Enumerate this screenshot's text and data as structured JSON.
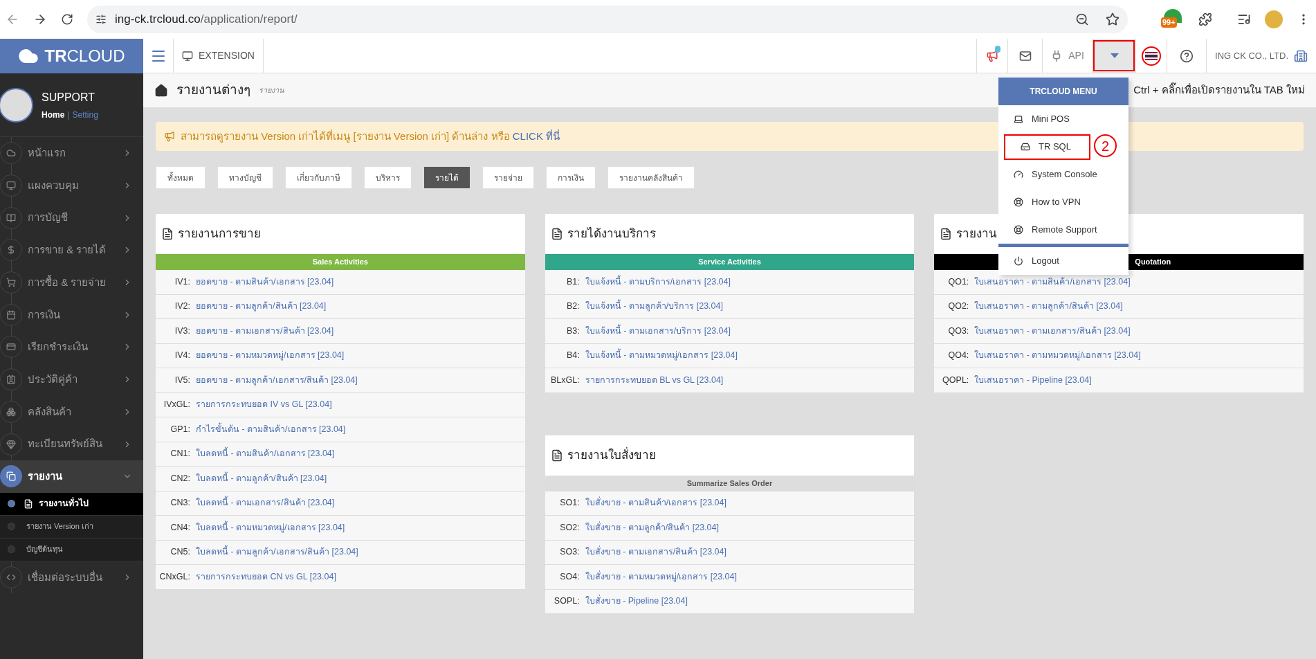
{
  "browser": {
    "url_host": "ing-ck.trcloud.co",
    "url_path": "/application/report/",
    "extension_badge": "99+"
  },
  "header": {
    "logo_bold": "TR",
    "logo_rest": "CLOUD",
    "extension": "EXTENSION",
    "api": "API",
    "menu_open": true,
    "caret_annotated": true,
    "flag_annotated": true,
    "company": "ING CK CO., LTD."
  },
  "profile": {
    "name": "SUPPORT",
    "home": "Home",
    "separator": "|",
    "setting": "Setting"
  },
  "sidebar": {
    "items": [
      {
        "label": "หน้าแรก",
        "expanded": false,
        "selected": false
      },
      {
        "label": "แผงควบคุม",
        "expanded": false,
        "selected": false
      },
      {
        "label": "การบัญชี",
        "expanded": false,
        "selected": false
      },
      {
        "label": "การขาย & รายได้",
        "expanded": false,
        "selected": false
      },
      {
        "label": "การซื้อ & รายจ่าย",
        "expanded": false,
        "selected": false
      },
      {
        "label": "การเงิน",
        "expanded": false,
        "selected": false
      },
      {
        "label": "เรียกชำระเงิน",
        "expanded": false,
        "selected": false
      },
      {
        "label": "ประวัติคู่ค้า",
        "expanded": false,
        "selected": false
      },
      {
        "label": "คลังสินค้า",
        "expanded": false,
        "selected": false
      },
      {
        "label": "ทะเบียนทรัพย์สิน",
        "expanded": false,
        "selected": false
      },
      {
        "label": "รายงาน",
        "expanded": true,
        "selected": true,
        "children": [
          {
            "label": "รายงานทั่วไป",
            "selected": true
          },
          {
            "label": "รายงาน Version เก่า",
            "selected": false
          },
          {
            "label": "บัญชีต้นทุน",
            "selected": false
          }
        ]
      },
      {
        "label": "เชื่อมต่อระบบอื่น",
        "expanded": false,
        "selected": false
      }
    ]
  },
  "page": {
    "title": "รายงานต่างๆ",
    "subtitle": "รายงาน",
    "hint": "Ctrl + คลิ๊กเพื่อเปิดรายงานใน TAB ใหม่"
  },
  "banner": {
    "text": "สามารถดูรายงาน Version เก่าได้ที่เมนู [รายงาน Version เก่า] ด้านล่าง หรือ",
    "link": "CLICK ที่นี่"
  },
  "filters": [
    {
      "label": "ทั้งหมด",
      "selected": false
    },
    {
      "label": "ทางบัญชี",
      "selected": false
    },
    {
      "label": "เกี่ยวกับภาษี",
      "selected": false
    },
    {
      "label": "บริหาร",
      "selected": false
    },
    {
      "label": "รายได้",
      "selected": true
    },
    {
      "label": "รายจ่าย",
      "selected": false
    },
    {
      "label": "การเงิน",
      "selected": false
    },
    {
      "label": "รายงานคลังสินค้า",
      "selected": false
    }
  ],
  "columns": [
    [
      {
        "title": "รายงานการขาย",
        "band": "Sales Activities",
        "color": "#7fb743",
        "covered": false,
        "rows": [
          {
            "code": "IV1:",
            "label": "ยอดขาย - ตามสินค้า/เอกสาร [23.04]"
          },
          {
            "code": "IV2:",
            "label": "ยอดขาย - ตามลูกค้า/สินค้า [23.04]"
          },
          {
            "code": "IV3:",
            "label": "ยอดขาย - ตามเอกสาร/สินค้า [23.04]"
          },
          {
            "code": "IV4:",
            "label": "ยอดขาย - ตามหมวดหมู่/เอกสาร [23.04]"
          },
          {
            "code": "IV5:",
            "label": "ยอดขาย - ตามลูกค้า/เอกสาร/สินค้า [23.04]"
          },
          {
            "code": "IVxGL:",
            "label": "รายการกระทบยอด IV vs GL [23.04]"
          },
          {
            "code": "GP1:",
            "label": "กำไรขั้นต้น - ตามสินค้า/เอกสาร [23.04]"
          },
          {
            "code": "CN1:",
            "label": "ใบลดหนี้ - ตามสินค้า/เอกสาร [23.04]"
          },
          {
            "code": "CN2:",
            "label": "ใบลดหนี้ - ตามลูกค้า/สินค้า [23.04]"
          },
          {
            "code": "CN3:",
            "label": "ใบลดหนี้ - ตามเอกสาร/สินค้า [23.04]"
          },
          {
            "code": "CN4:",
            "label": "ใบลดหนี้ - ตามหมวดหมู่/เอกสาร [23.04]"
          },
          {
            "code": "CN5:",
            "label": "ใบลดหนี้ - ตามลูกค้า/เอกสาร/สินค้า [23.04]"
          },
          {
            "code": "CNxGL:",
            "label": "รายการกระทบยอด CN vs GL [23.04]"
          }
        ]
      }
    ],
    [
      {
        "title": "รายได้งานบริการ",
        "band": "Service Activities",
        "color": "#30a78a",
        "covered": false,
        "rows": [
          {
            "code": "B1:",
            "label": "ใบแจ้งหนี้ - ตามบริการ/เอกสาร [23.04]"
          },
          {
            "code": "B2:",
            "label": "ใบแจ้งหนี้ - ตามลูกค้า/บริการ [23.04]"
          },
          {
            "code": "B3:",
            "label": "ใบแจ้งหนี้ - ตามเอกสาร/บริการ [23.04]"
          },
          {
            "code": "B4:",
            "label": "ใบแจ้งหนี้ - ตามหมวดหมู่/เอกสาร [23.04]"
          },
          {
            "code": "BLxGL:",
            "label": "รายการกระทบยอด BL vs GL [23.04]"
          }
        ]
      },
      {
        "title": "รายงานใบสั่งขาย",
        "band": "Summarize Sales Order",
        "color": "#dddddd",
        "covered": false,
        "rows": [
          {
            "code": "SO1:",
            "label": "ใบสั่งขาย - ตามสินค้า/เอกสาร [23.04]"
          },
          {
            "code": "SO2:",
            "label": "ใบสั่งขาย - ตามลูกค้า/สินค้า [23.04]"
          },
          {
            "code": "SO3:",
            "label": "ใบสั่งขาย - ตามเอกสาร/สินค้า [23.04]"
          },
          {
            "code": "SO4:",
            "label": "ใบสั่งขาย - ตามหมวดหมู่/เอกสาร [23.04]"
          },
          {
            "code": "SOPL:",
            "label": "ใบสั่งขาย - Pipeline [23.04]"
          }
        ]
      }
    ],
    [
      {
        "title": "รายงาน",
        "band": "Quotation",
        "color": "#000000",
        "covered": true,
        "rows": [
          {
            "code": "QO1:",
            "label": "ใบเสนอราคา - ตามสินค้า/เอกสาร [23.04]"
          },
          {
            "code": "QO2:",
            "label": "ใบเสนอราคา - ตามลูกค้า/สินค้า [23.04]"
          },
          {
            "code": "QO3:",
            "label": "ใบเสนอราคา - ตามเอกสาร/สินค้า [23.04]"
          },
          {
            "code": "QO4:",
            "label": "ใบเสนอราคา - ตามหมวดหมู่/เอกสาร [23.04]"
          },
          {
            "code": "QOPL:",
            "label": "ใบเสนอราคา - Pipeline [23.04]"
          }
        ]
      }
    ]
  ],
  "menu": {
    "title": "TRCLOUD MENU",
    "items": [
      {
        "label": "Mini POS",
        "annotated": false
      },
      {
        "label": "TR SQL",
        "annotated": true,
        "callout": "2"
      },
      {
        "label": "System Console",
        "annotated": false
      },
      {
        "label": "How to VPN",
        "annotated": false
      },
      {
        "label": "Remote Support",
        "annotated": false
      }
    ],
    "logout": "Logout"
  }
}
